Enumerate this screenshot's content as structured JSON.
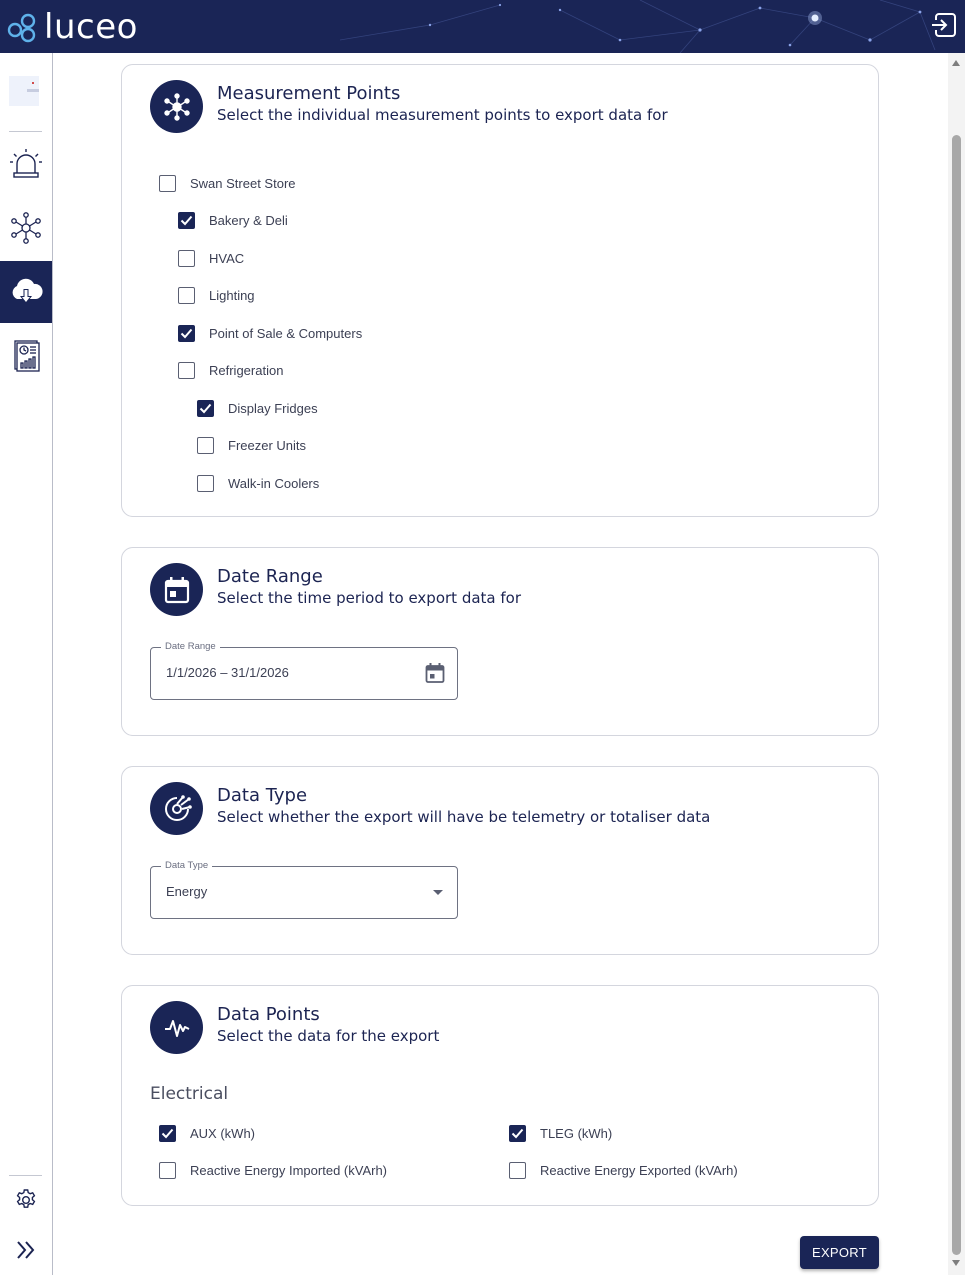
{
  "header": {
    "brand": "luceo"
  },
  "sidebar": {
    "items": [
      {
        "icon": "thumbnail-icon"
      },
      {
        "icon": "alarm-icon"
      },
      {
        "icon": "network-icon"
      },
      {
        "icon": "cloud-download-icon",
        "active": true
      },
      {
        "icon": "report-icon"
      },
      {
        "icon": "gear-icon"
      },
      {
        "icon": "expand-icon"
      }
    ]
  },
  "measurement": {
    "title": "Measurement Points",
    "subtitle": "Select the individual measurement points to export data for",
    "tree": [
      {
        "label": "Swan Street Store",
        "checked": false,
        "level": 0
      },
      {
        "label": "Bakery & Deli",
        "checked": true,
        "level": 1
      },
      {
        "label": "HVAC",
        "checked": false,
        "level": 1
      },
      {
        "label": "Lighting",
        "checked": false,
        "level": 1
      },
      {
        "label": "Point of Sale & Computers",
        "checked": true,
        "level": 1
      },
      {
        "label": "Refrigeration",
        "checked": false,
        "level": 1
      },
      {
        "label": "Display Fridges",
        "checked": true,
        "level": 2
      },
      {
        "label": "Freezer Units",
        "checked": false,
        "level": 2
      },
      {
        "label": "Walk-in Coolers",
        "checked": false,
        "level": 2
      }
    ]
  },
  "date_range": {
    "title": "Date Range",
    "subtitle": "Select the time period to export data for",
    "field_label": "Date Range",
    "value": "1/1/2026 – 31/1/2026"
  },
  "data_type": {
    "title": "Data Type",
    "subtitle": "Select whether the export will have be telemetry or totaliser data",
    "field_label": "Data Type",
    "value": "Energy"
  },
  "data_points": {
    "title": "Data Points",
    "subtitle": "Select the data for the export",
    "section": "Electrical",
    "items": [
      {
        "label": "AUX (kWh)",
        "checked": true
      },
      {
        "label": "TLEG (kWh)",
        "checked": true
      },
      {
        "label": "Reactive Energy Imported (kVArh)",
        "checked": false
      },
      {
        "label": "Reactive Energy Exported (kVArh)",
        "checked": false
      }
    ]
  },
  "actions": {
    "export_label": "EXPORT"
  },
  "colors": {
    "brand_navy": "#1a2556",
    "checkbox_checked": "#1a2556",
    "border": "#d4d6de"
  }
}
